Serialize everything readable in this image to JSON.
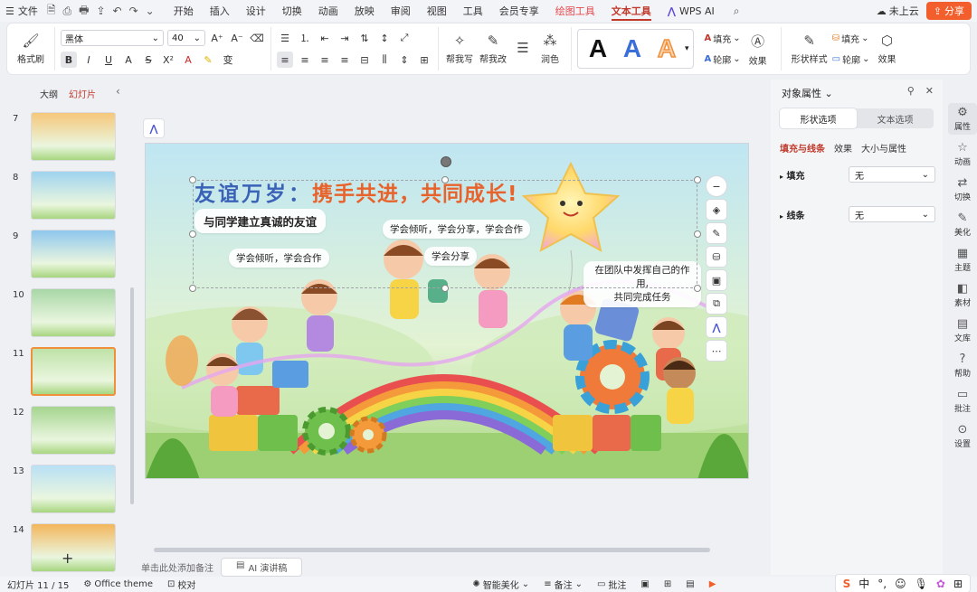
{
  "topbar": {
    "menu_label": "文件",
    "tabs": [
      "开始",
      "插入",
      "设计",
      "切换",
      "动画",
      "放映",
      "审阅",
      "视图",
      "工具",
      "会员专享",
      "绘图工具",
      "文本工具"
    ],
    "wps_ai": "WPS AI",
    "cloud": "未上云",
    "share": "分享"
  },
  "ribbon": {
    "format_painter": "格式刷",
    "font_name": "黑体",
    "font_size": "40",
    "help_write": "帮我写",
    "help_edit": "帮我改",
    "polish": "润色",
    "fill": "填充",
    "outline": "轮廓",
    "effects": "效果",
    "shape_style": "形状样式",
    "fill2": "填充",
    "outline2": "轮廓",
    "effects2": "效果",
    "style_letter": "A",
    "style_colors": [
      "#111111",
      "#3a6ed8",
      "#f0903a"
    ]
  },
  "left_panel": {
    "tab_outline": "大纲",
    "tab_slides": "幻灯片",
    "slides": [
      {
        "num": "7",
        "color": "#f6c77a"
      },
      {
        "num": "8",
        "color": "#9fd3ef"
      },
      {
        "num": "9",
        "color": "#8fc7ee"
      },
      {
        "num": "10",
        "color": "#a8d7a6"
      },
      {
        "num": "11",
        "color": "#bfe2a8"
      },
      {
        "num": "12",
        "color": "#a5d58f"
      },
      {
        "num": "13",
        "color": "#b8e0f5"
      },
      {
        "num": "14",
        "color": "#f3b65c"
      }
    ]
  },
  "slide": {
    "title_part1": "友谊万岁：",
    "title_part2": "携手共进，共同成长!",
    "bubble_main": "与同学建立真诚的友谊",
    "bubble_1": "学会倾听，学会分享，学会合作",
    "bubble_2": "学会倾听，学会合作",
    "bubble_3": "学会分享",
    "bubble_4": "在团队中发挥自己的作用,\n共同完成任务"
  },
  "notes": {
    "placeholder": "单击此处添加备注",
    "ai_button": "AI 演讲稿"
  },
  "right_panel": {
    "title": "对象属性",
    "tab_shape": "形状选项",
    "tab_text": "文本选项",
    "sub_fill_line": "填充与线条",
    "sub_effects": "效果",
    "sub_size": "大小与属性",
    "fill_label": "填充",
    "fill_value": "无",
    "line_label": "线条",
    "line_value": "无"
  },
  "sidebar": {
    "items": [
      "属性",
      "动画",
      "切换",
      "美化",
      "主题",
      "素材",
      "文库",
      "帮助",
      "批注",
      "设置"
    ]
  },
  "statusbar": {
    "slide_info": "幻灯片 11 / 15",
    "theme": "Office theme",
    "proofread": "校对",
    "smart_beautify": "智能美化",
    "notes": "备注",
    "comments": "批注"
  }
}
